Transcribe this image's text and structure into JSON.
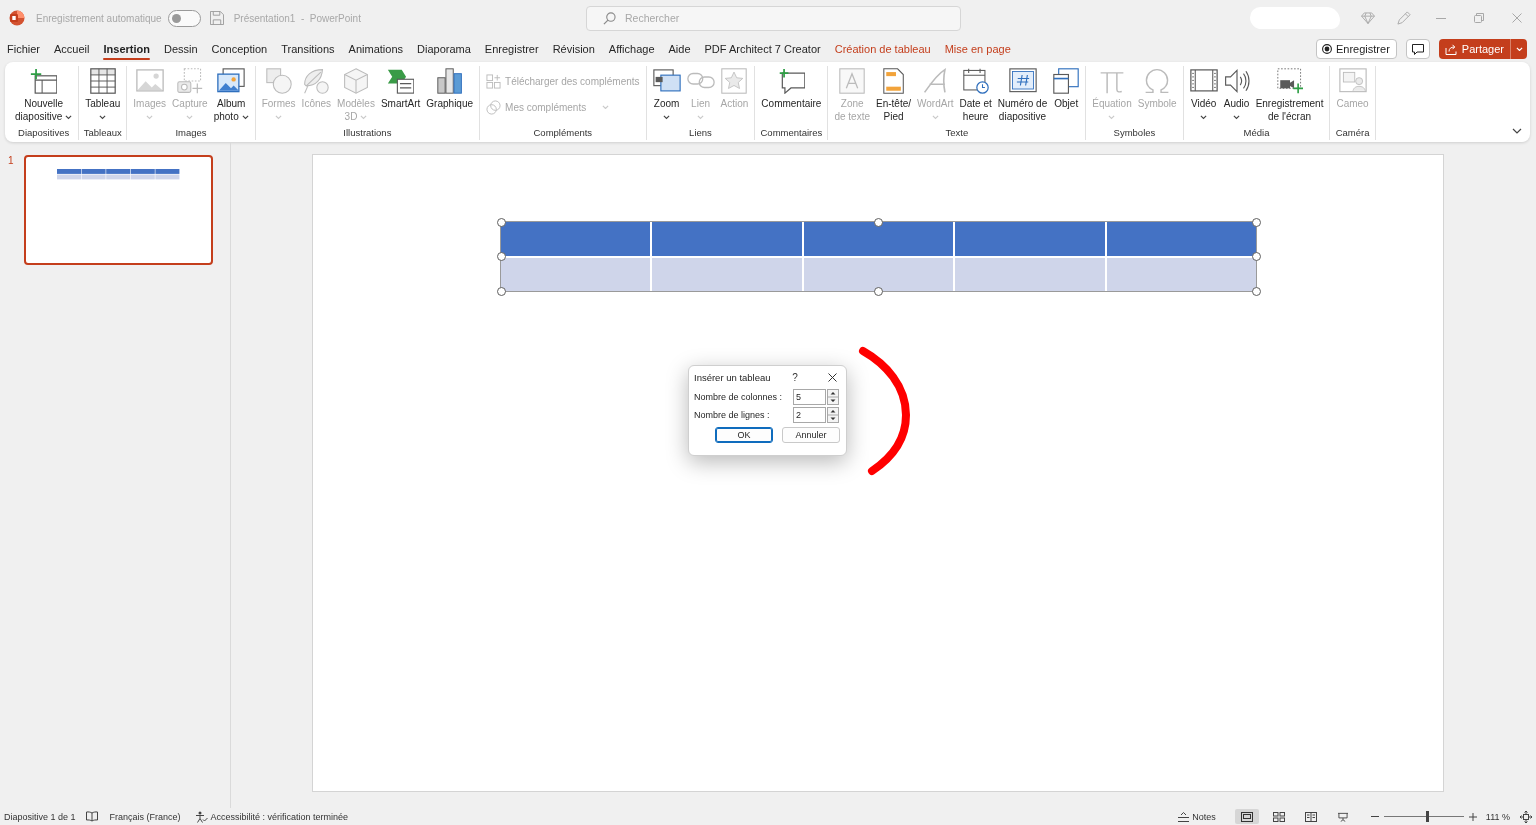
{
  "title_bar": {
    "autosave_label": "Enregistrement automatique",
    "autosave": {
      "on": false
    },
    "document_title": "Présentation1  -  PowerPoint",
    "search": {
      "placeholder": "Rechercher"
    }
  },
  "menu_tabs": [
    {
      "label": "Fichier",
      "selected": false,
      "contextual": false
    },
    {
      "label": "Accueil",
      "selected": false,
      "contextual": false
    },
    {
      "label": "Insertion",
      "selected": true,
      "contextual": false
    },
    {
      "label": "Dessin",
      "selected": false,
      "contextual": false
    },
    {
      "label": "Conception",
      "selected": false,
      "contextual": false
    },
    {
      "label": "Transitions",
      "selected": false,
      "contextual": false
    },
    {
      "label": "Animations",
      "selected": false,
      "contextual": false
    },
    {
      "label": "Diaporama",
      "selected": false,
      "contextual": false
    },
    {
      "label": "Enregistrer",
      "selected": false,
      "contextual": false
    },
    {
      "label": "Révision",
      "selected": false,
      "contextual": false
    },
    {
      "label": "Affichage",
      "selected": false,
      "contextual": false
    },
    {
      "label": "Aide",
      "selected": false,
      "contextual": false
    },
    {
      "label": "PDF Architect 7 Creator",
      "selected": false,
      "contextual": false
    },
    {
      "label": "Création de tableau",
      "selected": false,
      "contextual": true
    },
    {
      "label": "Mise en page",
      "selected": false,
      "contextual": true
    }
  ],
  "menu_actions": {
    "record_button": "Enregistrer",
    "share_button": "Partager"
  },
  "ribbon": {
    "groups": [
      {
        "label": "Diapositives",
        "buttons": [
          {
            "kind": "large",
            "label": [
              "Nouvelle",
              "diapositive"
            ],
            "dropdown": true,
            "disabled": false
          }
        ]
      },
      {
        "label": "Tableaux",
        "buttons": [
          {
            "kind": "large",
            "label": [
              "Tableau"
            ],
            "dropdown": true,
            "disabled": false
          }
        ]
      },
      {
        "label": "Images",
        "buttons": [
          {
            "kind": "large",
            "label": [
              "Images"
            ],
            "dropdown": true,
            "disabled": true
          },
          {
            "kind": "large",
            "label": [
              "Capture"
            ],
            "dropdown": true,
            "disabled": true
          },
          {
            "kind": "large",
            "label": [
              "Album",
              "photo"
            ],
            "dropdown": true,
            "disabled": false
          }
        ]
      },
      {
        "label": "Illustrations",
        "buttons": [
          {
            "kind": "large",
            "label": [
              "Formes"
            ],
            "dropdown": true,
            "disabled": true
          },
          {
            "kind": "large",
            "label": [
              "Icônes"
            ],
            "dropdown": false,
            "disabled": true
          },
          {
            "kind": "large",
            "label": [
              "Modèles",
              "3D"
            ],
            "dropdown": true,
            "disabled": true
          },
          {
            "kind": "large",
            "label": [
              "SmartArt"
            ],
            "dropdown": false,
            "disabled": false
          },
          {
            "kind": "large",
            "label": [
              "Graphique"
            ],
            "dropdown": false,
            "disabled": false
          }
        ]
      },
      {
        "label": "Compléments",
        "buttons": [
          {
            "kind": "small",
            "label": [
              "Télécharger des compléments"
            ],
            "dropdown": false,
            "disabled": true
          },
          {
            "kind": "small",
            "label": [
              "Mes compléments"
            ],
            "dropdown": true,
            "disabled": true
          }
        ]
      },
      {
        "label": "Liens",
        "buttons": [
          {
            "kind": "large",
            "label": [
              "Zoom"
            ],
            "dropdown": true,
            "disabled": false
          },
          {
            "kind": "large",
            "label": [
              "Lien"
            ],
            "dropdown": true,
            "disabled": true
          },
          {
            "kind": "large",
            "label": [
              "Action"
            ],
            "dropdown": false,
            "disabled": true
          }
        ]
      },
      {
        "label": "Commentaires",
        "buttons": [
          {
            "kind": "large",
            "label": [
              "Commentaire"
            ],
            "dropdown": false,
            "disabled": false
          }
        ]
      },
      {
        "label": "Texte",
        "buttons": [
          {
            "kind": "large",
            "label": [
              "Zone",
              "de texte"
            ],
            "dropdown": false,
            "disabled": true
          },
          {
            "kind": "large",
            "label": [
              "En-tête/",
              "Pied"
            ],
            "dropdown": false,
            "disabled": false
          },
          {
            "kind": "large",
            "label": [
              "WordArt"
            ],
            "dropdown": true,
            "disabled": true
          },
          {
            "kind": "large",
            "label": [
              "Date et",
              "heure"
            ],
            "dropdown": false,
            "disabled": false
          },
          {
            "kind": "large",
            "label": [
              "Numéro de",
              "diapositive"
            ],
            "dropdown": false,
            "disabled": false
          },
          {
            "kind": "large",
            "label": [
              "Objet"
            ],
            "dropdown": false,
            "disabled": false
          }
        ]
      },
      {
        "label": "Symboles",
        "buttons": [
          {
            "kind": "large",
            "label": [
              "Équation"
            ],
            "dropdown": true,
            "disabled": true
          },
          {
            "kind": "large",
            "label": [
              "Symbole"
            ],
            "dropdown": false,
            "disabled": true
          }
        ]
      },
      {
        "label": "Média",
        "buttons": [
          {
            "kind": "large",
            "label": [
              "Vidéo"
            ],
            "dropdown": true,
            "disabled": false
          },
          {
            "kind": "large",
            "label": [
              "Audio"
            ],
            "dropdown": true,
            "disabled": false
          },
          {
            "kind": "large",
            "label": [
              "Enregistrement",
              "de l'écran"
            ],
            "dropdown": false,
            "disabled": false
          }
        ]
      },
      {
        "label": "Caméra",
        "buttons": [
          {
            "kind": "large",
            "label": [
              "Cameo"
            ],
            "dropdown": false,
            "disabled": true
          }
        ]
      }
    ]
  },
  "thumbnails": [
    {
      "number": "1",
      "selected": true
    }
  ],
  "slide": {
    "table": {
      "selected": true,
      "rows": [
        {
          "cells": [
            {
              "kind": "header"
            },
            {
              "kind": "header"
            },
            {
              "kind": "header"
            },
            {
              "kind": "header"
            },
            {
              "kind": "header"
            }
          ]
        },
        {
          "cells": [
            {
              "kind": "band"
            },
            {
              "kind": "band"
            },
            {
              "kind": "band"
            },
            {
              "kind": "band"
            },
            {
              "kind": "band"
            }
          ]
        }
      ]
    }
  },
  "dialog": {
    "title": "Insérer un tableau",
    "help": "?",
    "fields": [
      {
        "label": "Nombre de colonnes :",
        "value": "5"
      },
      {
        "label": "Nombre de lignes :",
        "value": "2"
      }
    ],
    "buttons": [
      {
        "label": "OK",
        "default": true
      },
      {
        "label": "Annuler",
        "default": false
      }
    ]
  },
  "status_bar": {
    "slide_position": "Diapositive 1 de 1",
    "language": "Français (France)",
    "accessibility": "Accessibilité : vérification terminée",
    "notes_button": "Notes",
    "views": [
      {
        "selected": true
      },
      {
        "selected": false
      },
      {
        "selected": false
      },
      {
        "selected": false
      }
    ],
    "zoom": {
      "level": 0.54,
      "reading": "111 %"
    }
  }
}
